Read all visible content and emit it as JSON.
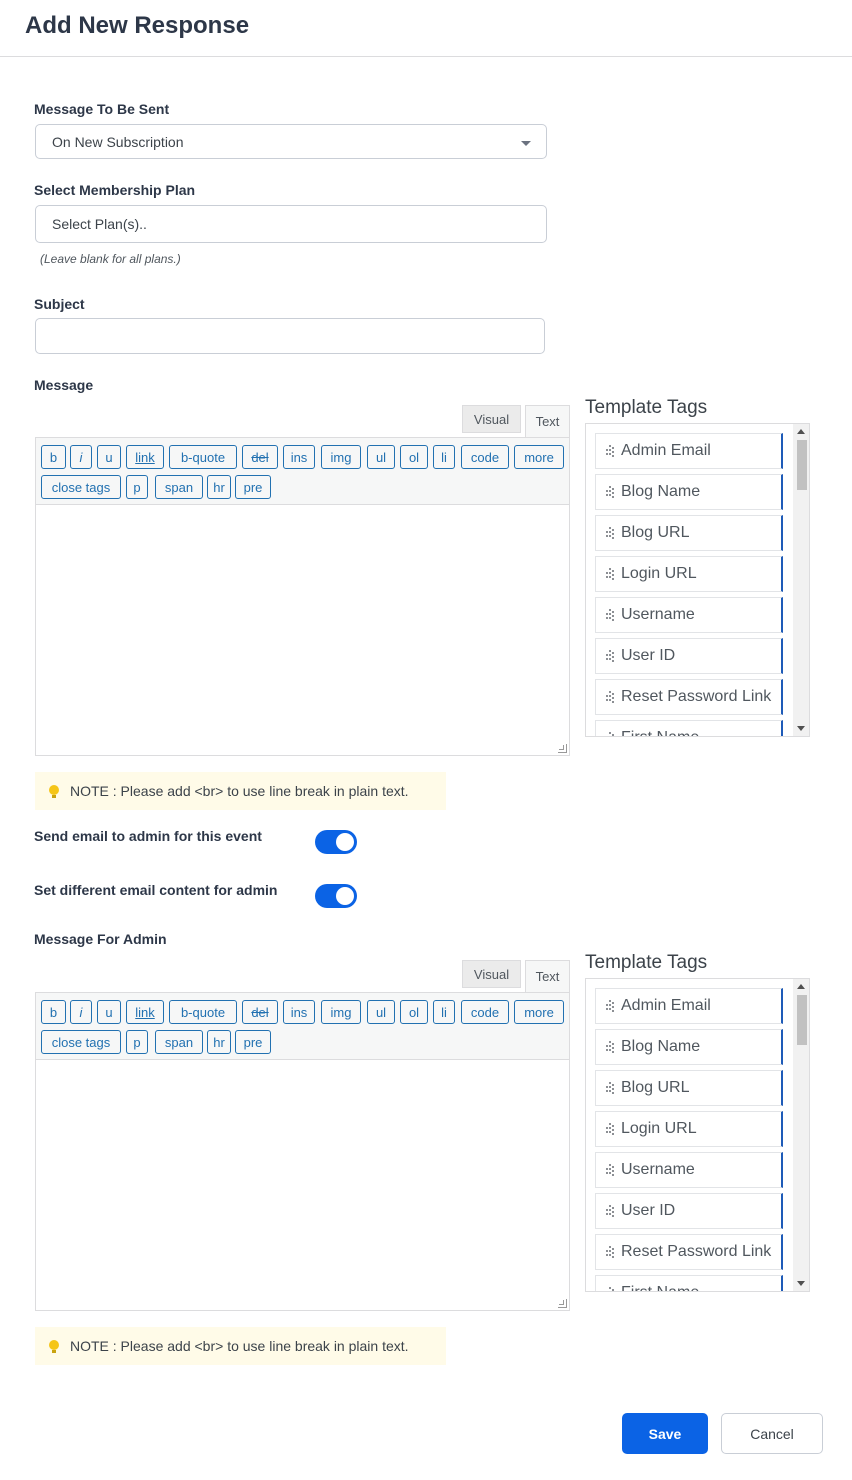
{
  "header": {
    "title": "Add New Response"
  },
  "form": {
    "message_label": "Message To Be Sent",
    "message_value": "On New Subscription",
    "plan_label": "Select Membership Plan",
    "plan_placeholder": "Select Plan(s)..",
    "plan_hint": "(Leave blank for all plans.)",
    "subject_label": "Subject",
    "subject_value": "",
    "body_label": "Message",
    "admin_body_label": "Message For Admin"
  },
  "editor": {
    "tab_visual": "Visual",
    "tab_text": "Text",
    "buttons": [
      "b",
      "i",
      "u",
      "link",
      "b-quote",
      "del",
      "ins",
      "img",
      "ul",
      "ol",
      "li",
      "code",
      "more",
      "close tags",
      "p",
      "span",
      "hr",
      "pre"
    ]
  },
  "note": {
    "text": "NOTE : Please add <br> to use line break in plain text."
  },
  "toggles": {
    "send_admin_label": "Send email to admin for this event",
    "send_admin_on": true,
    "diff_content_label": "Set different email content for admin",
    "diff_content_on": true
  },
  "template_tags": {
    "title": "Template Tags",
    "items": [
      "Admin Email",
      "Blog Name",
      "Blog URL",
      "Login URL",
      "Username",
      "User ID",
      "Reset Password Link",
      "First Name"
    ]
  },
  "actions": {
    "save": "Save",
    "cancel": "Cancel"
  },
  "colors": {
    "primary": "#0b63e5",
    "editor_button": "#2271b1",
    "note_bg": "#fffbe8",
    "tag_accent": "#1e5bb8"
  }
}
